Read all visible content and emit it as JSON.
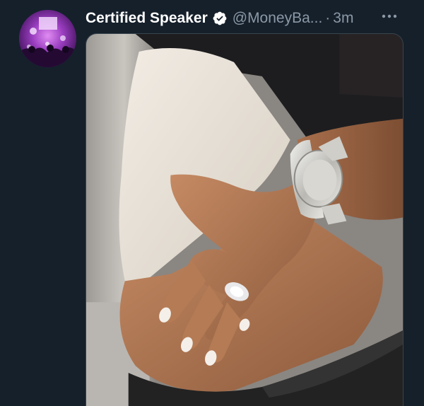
{
  "tweet": {
    "display_name": "Certified Speaker",
    "handle": "@MoneyBa...",
    "separator": "·",
    "time": "3m",
    "verified": true,
    "avatar_icon": "concert-photo-avatar",
    "more_icon": "more-dots-icon",
    "media": {
      "type": "photo"
    }
  },
  "colors": {
    "background": "#15202b",
    "name": "#ffffff",
    "secondary_text": "#8b98a5",
    "verified_badge": "#ffffff",
    "media_border": "#38444d"
  }
}
